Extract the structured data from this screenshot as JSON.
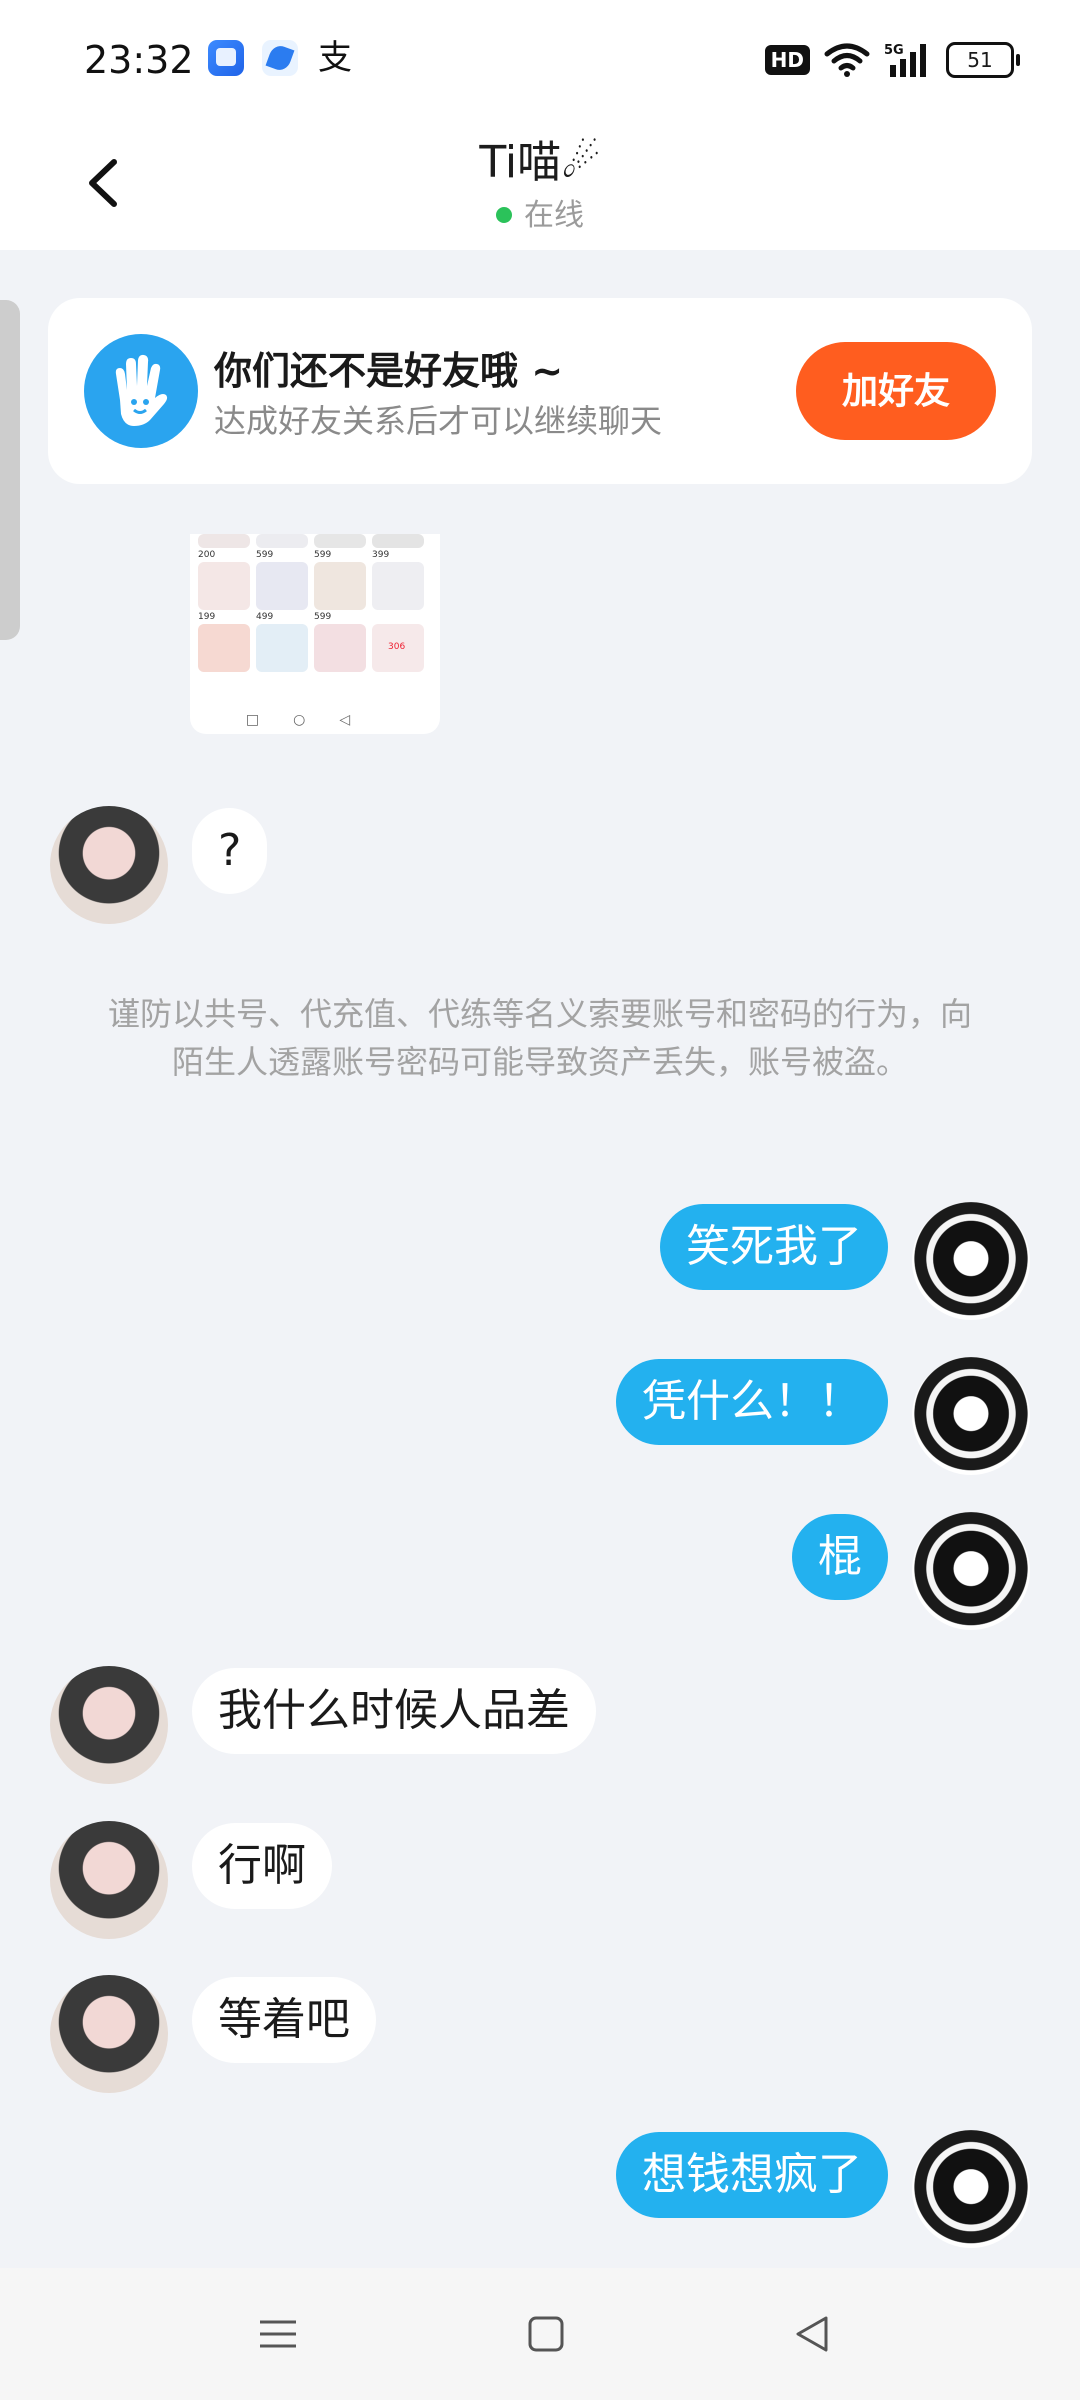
{
  "status_bar": {
    "time": "23:32",
    "app_icons": [
      "task-app-icon",
      "feather-app-icon",
      "alipay-icon"
    ],
    "alipay_glyph": "支",
    "hd_label": "HD",
    "network_label": "5G",
    "battery_level": "51"
  },
  "header": {
    "title": "Ti喵☄",
    "status": "在线",
    "status_color": "#2bc25a"
  },
  "friend_card": {
    "title": "你们还不是好友哦 ~",
    "subtitle": "达成好友关系后才可以继续聊天",
    "button_label": "加好友",
    "button_color": "#ff5d1f"
  },
  "shared_image": {
    "prices_row1": [
      "200",
      "599",
      "599",
      "399"
    ],
    "prices_row2": [
      "199",
      "499",
      "599",
      ""
    ],
    "badge": "306"
  },
  "warning": "谨防以共号、代充值、代练等名义索要账号和密码的行为，向陌生人透露账号密码可能导致资产丢失，账号被盗。",
  "messages": [
    {
      "side": "left",
      "text": "?"
    },
    {
      "side": "right",
      "text": "笑死我了"
    },
    {
      "side": "right",
      "text": "凭什么！！"
    },
    {
      "side": "right",
      "text": "棍"
    },
    {
      "side": "left",
      "text": "我什么时候人品差"
    },
    {
      "side": "left",
      "text": "行啊"
    },
    {
      "side": "left",
      "text": "等着吧"
    },
    {
      "side": "right",
      "text": "想钱想疯了"
    }
  ],
  "colors": {
    "outgoing_bubble": "#23b1ef",
    "incoming_bubble": "#ffffff",
    "background": "#f1f3f7"
  },
  "nav_bar": {
    "icons": [
      "menu-icon",
      "home-square-icon",
      "back-triangle-icon"
    ]
  }
}
